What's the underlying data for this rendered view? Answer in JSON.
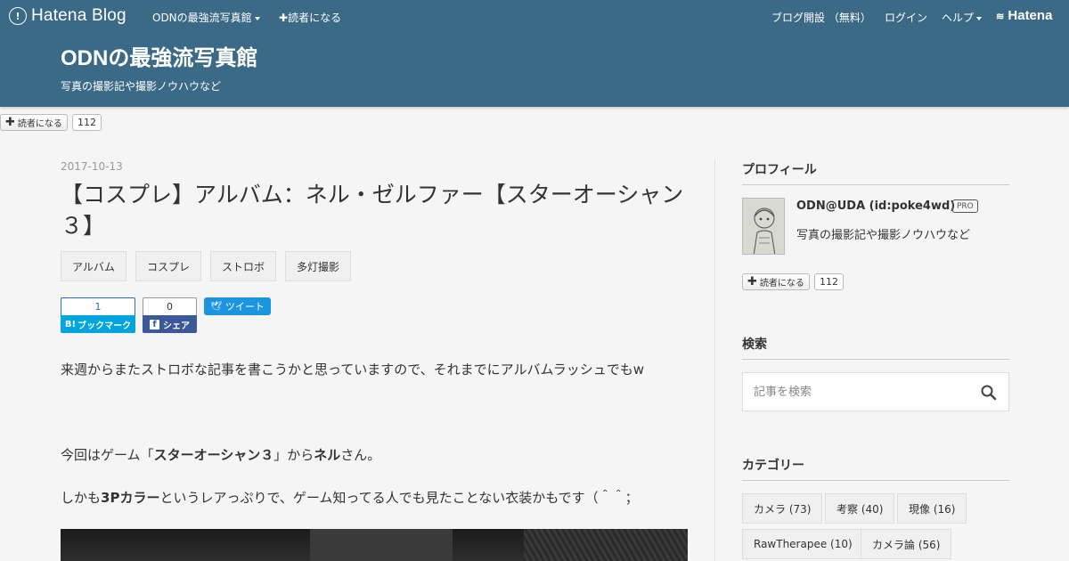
{
  "globalbar": {
    "logo_text": "Hatena Blog",
    "blog_menu": "ODNの最強流写真館",
    "subscribe": "読者になる",
    "blog_signup": "ブログ開設 （無料）",
    "login": "ログイン",
    "help": "ヘルプ",
    "hatena_logo": "Hatena"
  },
  "header": {
    "title": "ODNの最強流写真館",
    "description": "写真の撮影記や撮影ノウハウなど"
  },
  "subscribe_top": {
    "label": "読者になる",
    "count": "112"
  },
  "entry": {
    "date": "2017-10-13",
    "title": "【コスプレ】アルバム：ネル・ゼルファー【スターオーシャン３】",
    "tags": [
      "アルバム",
      "コスプレ",
      "ストロボ",
      "多灯撮影"
    ],
    "social": {
      "hatena_count": "1",
      "hatena_label": "ブックマーク",
      "hatena_prefix": "B!",
      "facebook_count": "0",
      "facebook_label": "シェア",
      "tweet_label": "ツイート"
    },
    "para1": "来週からまたストロボな記事を書こうかと思っていますので、それまでにアルバムラッシュでもw",
    "para2": {
      "t1": "今回はゲーム「",
      "b1": "スターオーシャン３",
      "t2": "」から",
      "b2": "ネル",
      "t3": "さん。"
    },
    "para3": {
      "t1": "しかも",
      "b1": "3Pカラー",
      "t2": "というレアっぷりで、ゲーム知ってる人でも見たことない衣装かもです（＾＾；"
    }
  },
  "sidebar": {
    "profile_title": "プロフィール",
    "profile_name": "ODN@UDA (id:poke4wd)",
    "pro_badge": "PRO",
    "profile_desc": "写真の撮影記や撮影ノウハウなど",
    "subscribe_label": "読者になる",
    "subscribe_count": "112",
    "search_title": "検索",
    "search_placeholder": "記事を検索",
    "category_title": "カテゴリー",
    "categories": [
      "カメラ (73)",
      "考察 (40)",
      "現像 (16)",
      "RawTherapee (10)",
      "カメラ論 (56)"
    ]
  },
  "colors": {
    "header_bg": "#3b6a87",
    "hatena_blue": "#00a4de",
    "facebook_blue": "#3b5998",
    "twitter_blue": "#1b95e0"
  },
  "icons": [
    "hatena-logo-icon",
    "plus-icon",
    "caret-down-icon",
    "search-icon",
    "facebook-icon",
    "twitter-bird-icon"
  ]
}
